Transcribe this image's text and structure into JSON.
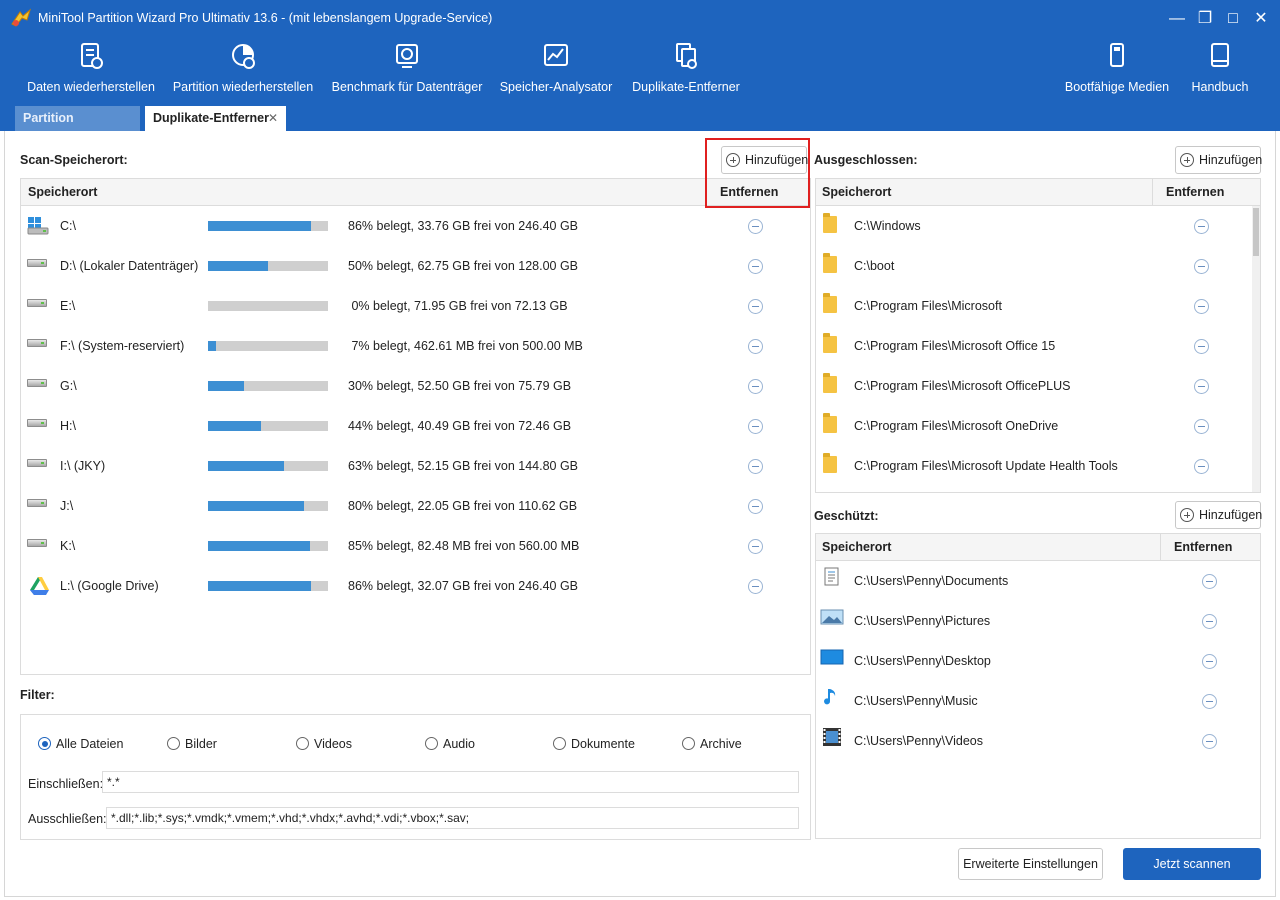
{
  "window": {
    "title": "MiniTool Partition Wizard Pro Ultimativ 13.6 - (mit lebenslangem Upgrade-Service)"
  },
  "toolbar": {
    "items": [
      {
        "label": "Daten wiederherstellen",
        "icon": "data-recovery-icon"
      },
      {
        "label": "Partition wiederherstellen",
        "icon": "partition-recovery-icon"
      },
      {
        "label": "Benchmark für Datenträger",
        "icon": "benchmark-icon"
      },
      {
        "label": "Speicher-Analysator",
        "icon": "space-analyzer-icon"
      },
      {
        "label": "Duplikate-Entferner",
        "icon": "duplicate-remover-icon"
      }
    ],
    "right_items": [
      {
        "label": "Bootfähige Medien",
        "icon": "bootable-media-icon"
      },
      {
        "label": "Handbuch",
        "icon": "manual-icon"
      }
    ]
  },
  "tabs": [
    {
      "label": "Partition verwalten",
      "active": false
    },
    {
      "label": "Duplikate-Entferner",
      "active": true
    }
  ],
  "scan_location": {
    "label": "Scan-Speicherort:",
    "add_label": "Hinzufügen",
    "col_location": "Speicherort",
    "col_remove": "Entfernen",
    "rows": [
      {
        "name": "C:\\",
        "icon": "windows-drive-icon",
        "usage_pct": 86,
        "info": "86% belegt, 33.76 GB frei von 246.40 GB"
      },
      {
        "name": "D:\\ (Lokaler Datenträger)",
        "icon": "drive-icon",
        "usage_pct": 50,
        "info": "50% belegt, 62.75 GB frei von 128.00 GB"
      },
      {
        "name": "E:\\",
        "icon": "drive-icon",
        "usage_pct": 0,
        "info": " 0% belegt, 71.95 GB frei von 72.13 GB"
      },
      {
        "name": "F:\\ (System-reserviert)",
        "icon": "drive-icon",
        "usage_pct": 7,
        "info": " 7% belegt, 462.61 MB frei von 500.00 MB"
      },
      {
        "name": "G:\\",
        "icon": "drive-icon",
        "usage_pct": 30,
        "info": "30% belegt, 52.50 GB frei von 75.79 GB"
      },
      {
        "name": "H:\\",
        "icon": "drive-icon",
        "usage_pct": 44,
        "info": "44% belegt, 40.49 GB frei von 72.46 GB"
      },
      {
        "name": "I:\\ (JKY)",
        "icon": "drive-icon",
        "usage_pct": 63,
        "info": "63% belegt, 52.15 GB frei von 144.80 GB"
      },
      {
        "name": "J:\\",
        "icon": "drive-icon",
        "usage_pct": 80,
        "info": "80% belegt, 22.05 GB frei von 110.62 GB"
      },
      {
        "name": "K:\\",
        "icon": "drive-icon",
        "usage_pct": 85,
        "info": "85% belegt, 82.48 MB frei von 560.00 MB"
      },
      {
        "name": "L:\\ (Google Drive)",
        "icon": "google-drive-icon",
        "usage_pct": 86,
        "info": "86% belegt, 32.07 GB frei von 246.40 GB"
      }
    ]
  },
  "excluded": {
    "label": "Ausgeschlossen:",
    "add_label": "Hinzufügen",
    "col_location": "Speicherort",
    "col_remove": "Entfernen",
    "rows": [
      "C:\\Windows",
      "C:\\boot",
      "C:\\Program Files\\Microsoft",
      "C:\\Program Files\\Microsoft Office 15",
      "C:\\Program Files\\Microsoft OfficePLUS",
      "C:\\Program Files\\Microsoft OneDrive",
      "C:\\Program Files\\Microsoft Update Health Tools"
    ]
  },
  "protected": {
    "label": "Geschützt:",
    "add_label": "Hinzufügen",
    "col_location": "Speicherort",
    "col_remove": "Entfernen",
    "rows": [
      {
        "path": "C:\\Users\\Penny\\Documents",
        "icon": "documents-icon"
      },
      {
        "path": "C:\\Users\\Penny\\Pictures",
        "icon": "pictures-icon"
      },
      {
        "path": "C:\\Users\\Penny\\Desktop",
        "icon": "desktop-icon"
      },
      {
        "path": "C:\\Users\\Penny\\Music",
        "icon": "music-icon"
      },
      {
        "path": "C:\\Users\\Penny\\Videos",
        "icon": "videos-icon"
      }
    ]
  },
  "filter": {
    "label": "Filter:",
    "options": [
      {
        "label": "Alle Dateien",
        "selected": true
      },
      {
        "label": "Bilder",
        "selected": false
      },
      {
        "label": "Videos",
        "selected": false
      },
      {
        "label": "Audio",
        "selected": false
      },
      {
        "label": "Dokumente",
        "selected": false
      },
      {
        "label": "Archive",
        "selected": false
      }
    ],
    "include_label": "Einschließen:",
    "include_value": "*.*",
    "exclude_label": "Ausschließen:",
    "exclude_value": "*.dll;*.lib;*.sys;*.vmdk;*.vmem;*.vhd;*.vhdx;*.avhd;*.vdi;*.vbox;*.sav;"
  },
  "buttons": {
    "advanced": "Erweiterte Einstellungen",
    "scan": "Jetzt scannen"
  },
  "colors": {
    "brand": "#1e64be",
    "bar_fill": "#3d8fd3",
    "highlight": "#e02020"
  }
}
